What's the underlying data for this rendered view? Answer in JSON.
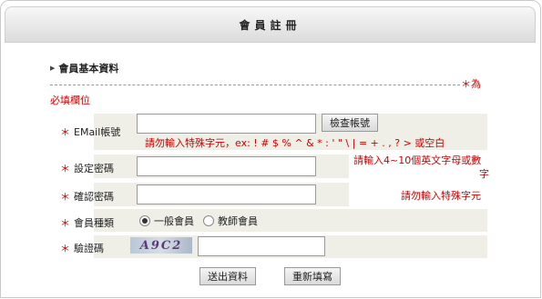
{
  "header": {
    "title": "會員註冊"
  },
  "section": {
    "title": "會員基本資料",
    "required_note_part1": "＊為",
    "required_note_part2": "必填欄位"
  },
  "form": {
    "email_label": "EMail帳號",
    "email_value": "",
    "check_button": "檢查帳號",
    "email_hint": "請勿輸入特殊字元，ex: ! # $ % ^ & * : ' \" \\ | = + . , ? > 或空白",
    "password_label": "設定密碼",
    "password_hint_line1": "請輸入4~10個英文字母或數",
    "password_hint_line2": "字",
    "confirm_label": "確認密碼",
    "confirm_hint": "請勿輸入特殊字元",
    "member_type_label": "會員種類",
    "member_type_options": [
      "一般會員",
      "教師會員"
    ],
    "member_type_selected": "一般會員",
    "captcha_label": "驗證碼",
    "captcha_image_text": "A9C2",
    "captcha_value": "",
    "submit_button": "送出資料",
    "reset_button": "重新填寫"
  },
  "colors": {
    "required": "#cc0000",
    "row_bg": "#efefe8"
  }
}
